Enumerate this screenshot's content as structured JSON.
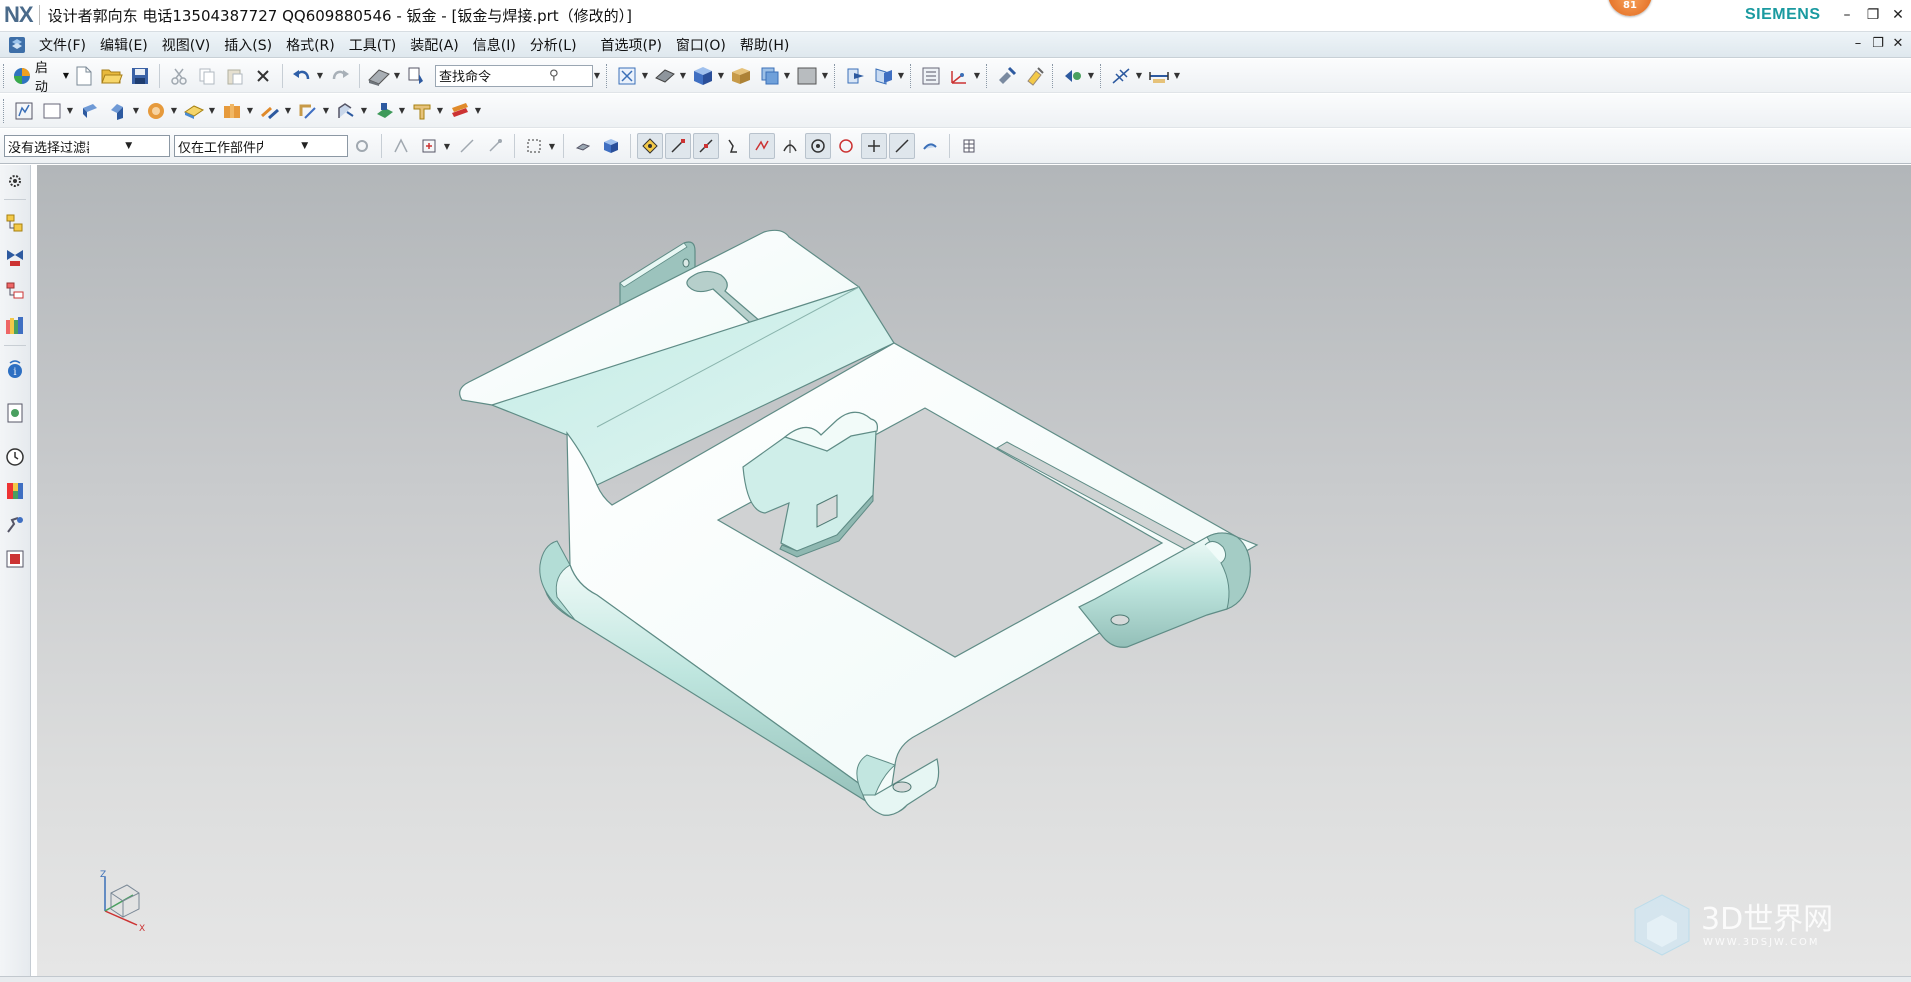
{
  "window": {
    "logo": "NX",
    "title": "设计者郭向东  电话13504387727  QQ609880546 - 钣金 - [钣金与焊接.prt（修改的）]",
    "notification_count": "81",
    "brand": "SIEMENS"
  },
  "menu": {
    "items": [
      "文件(F)",
      "编辑(E)",
      "视图(V)",
      "插入(S)",
      "格式(R)",
      "工具(T)",
      "装配(A)",
      "信息(I)",
      "分析(L)",
      "首选项(P)",
      "窗口(O)",
      "帮助(H)"
    ]
  },
  "toolbar": {
    "start_label": "启动",
    "command_search_placeholder": "查找命令"
  },
  "selection": {
    "filter_value": "没有选择过滤器",
    "scope_value": "仅在工作部件内"
  },
  "triad": {
    "z": "Z",
    "x": "X"
  },
  "watermark": {
    "text": "3D世界网",
    "url": "WWW.3DSJW.COM"
  },
  "colors": {
    "model_fill": "#e6f6f3",
    "model_shade": "#9fc7c0",
    "model_edge": "#5f8c86",
    "brand_teal": "#1a9aa0"
  }
}
